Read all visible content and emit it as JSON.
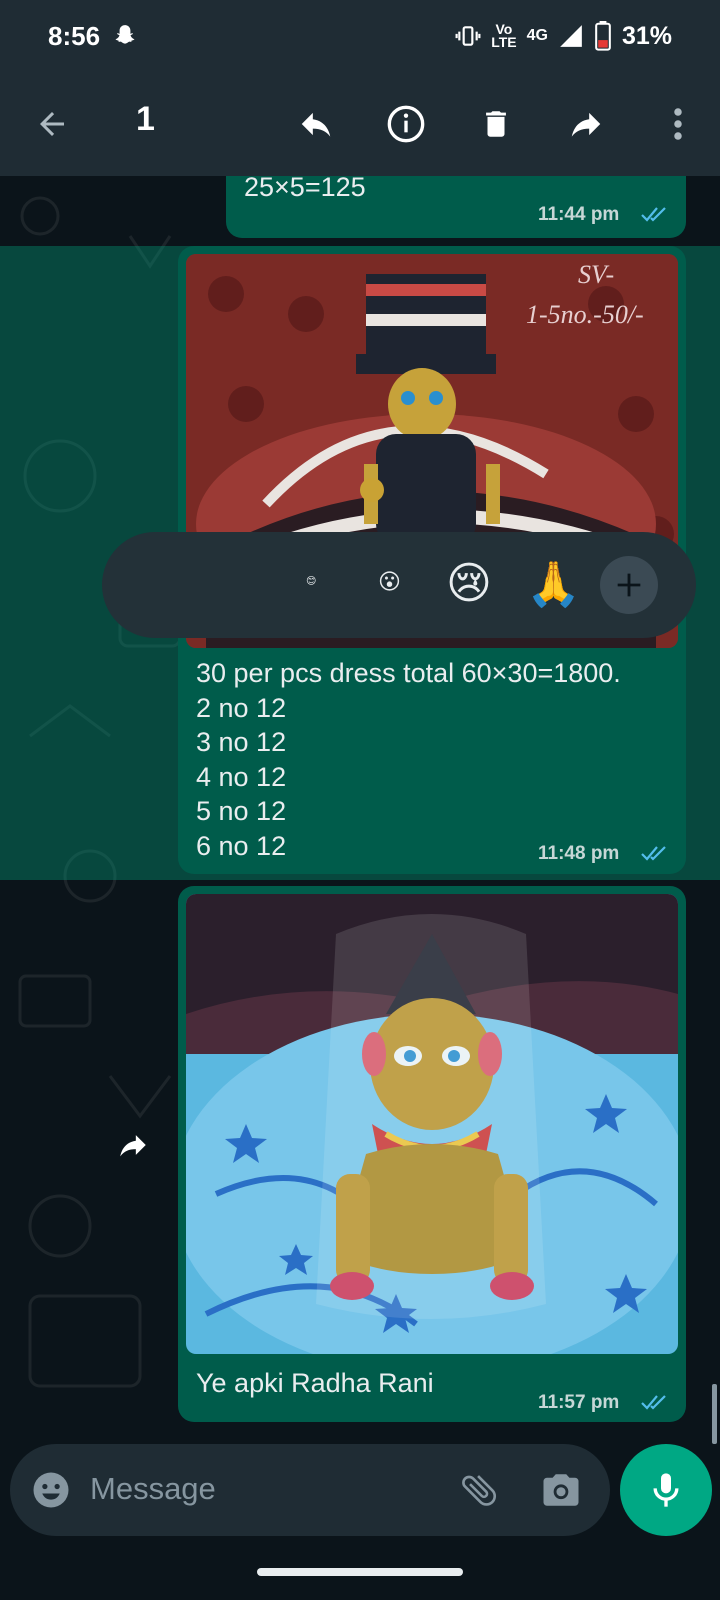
{
  "status_bar": {
    "time": "8:56",
    "network_top": "Vo",
    "network_bottom": "LTE",
    "network_type": "4G",
    "battery": "31%"
  },
  "app_bar": {
    "selected_count": "1",
    "icons": [
      "back-arrow-icon",
      "reply-icon",
      "info-icon",
      "delete-icon",
      "forward-icon",
      "more-options-icon"
    ]
  },
  "messages": [
    {
      "text": "25×5=125",
      "time": "11:44 pm"
    },
    {
      "photo_caption_overlay_1": "SV-",
      "photo_caption_overlay_2": "1-5no.-50/-",
      "lines": [
        "30 per pcs dress total 60×30=1800.",
        "2 no 12",
        "3 no 12",
        "4 no 12",
        "5 no 12",
        "6 no 12"
      ],
      "time": "11:48 pm"
    },
    {
      "text": "Ye apki Radha Rani",
      "time": "11:57 pm"
    }
  ],
  "reactions": {
    "emojis": [
      "😊",
      "😮",
      "😢",
      "🙏"
    ],
    "add_icon": "plus-icon"
  },
  "composer": {
    "placeholder": "Message"
  },
  "colors": {
    "bubble": "#005c4b",
    "accent": "#00a884",
    "bar": "#1f2c34",
    "tick": "#53bdeb"
  }
}
